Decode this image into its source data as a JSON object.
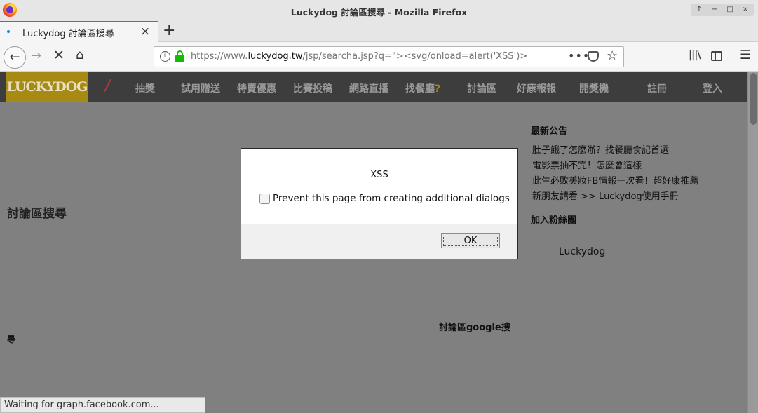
{
  "window": {
    "title": "Luckydog 討論區搜尋 - Mozilla Firefox",
    "controls": [
      "↑",
      "−",
      "□",
      "×"
    ]
  },
  "tab": {
    "title": "Luckydog 討論區搜尋",
    "close": "×",
    "new_tab": "+"
  },
  "nav": {
    "back": "←",
    "forward": "→",
    "stop": "✕",
    "home": "⌂",
    "url_prefix": "https://www.",
    "url_domain": "luckydog.tw",
    "url_rest": "/jsp/searcha.jsp?q=\"><svg/onload=alert('XSS')>",
    "info": "i",
    "more": "•••",
    "star": "☆",
    "library": "|||\\",
    "menu": "☰"
  },
  "site": {
    "logo": "LUCKYDOG",
    "slash": "/",
    "menu": [
      "抽獎",
      "試用贈送",
      "特賣優惠",
      "比賽投稿",
      "網路直播",
      "找餐廳",
      "討論區",
      "好康報報",
      "開獎機",
      "註冊",
      "登入"
    ],
    "restaurant_suffix": "?"
  },
  "sidebar": {
    "announcements_heading": "最新公告",
    "announcements": [
      "肚子餓了怎麼辦？找餐廳食記首選",
      "電影票抽不完！怎麼會這樣",
      "此生必敗美妝FB情報一次看！超好康推薦",
      "新朋友請看 >> Luckydog使用手冊"
    ],
    "fans_heading": "加入粉絲團",
    "fans_name": "Luckydog"
  },
  "main": {
    "search_title": "討論區搜尋",
    "google_search": "討論區google搜",
    "google_search_wrap": "尋"
  },
  "status": {
    "text": "Waiting for graph.facebook.com..."
  },
  "dialog": {
    "message": "XSS",
    "checkbox_label": "Prevent this page from creating additional dialogs",
    "ok_label": "OK"
  }
}
